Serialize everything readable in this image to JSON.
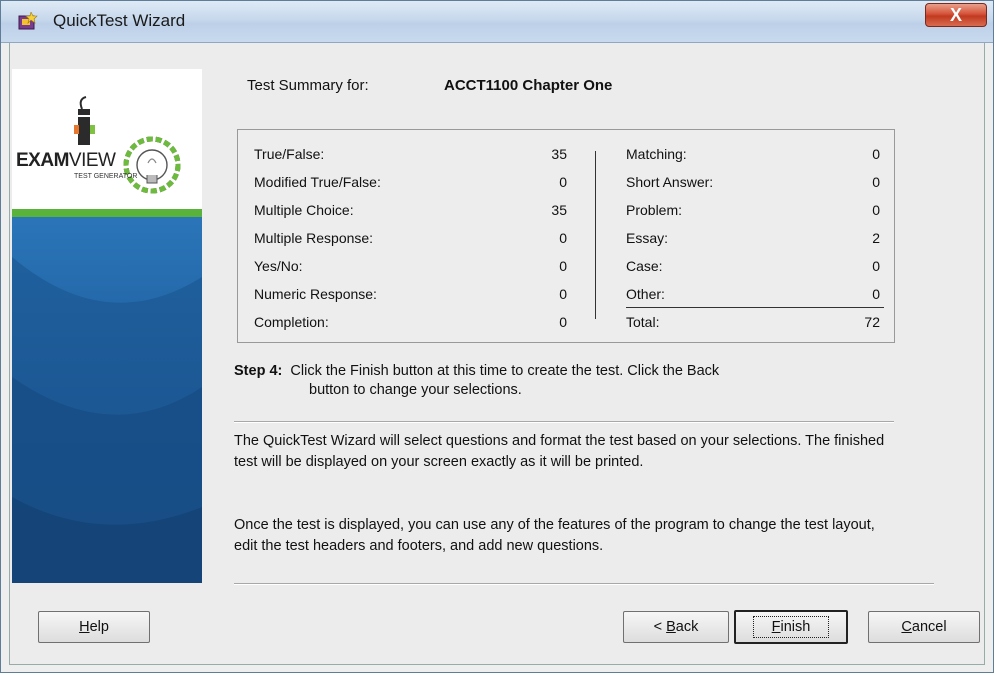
{
  "window": {
    "title": "QuickTest Wizard",
    "close_label": "X"
  },
  "branding": {
    "logo_bold": "EXAM",
    "logo_thin": "VIEW",
    "logo_sub": "TEST GENERATOR"
  },
  "summary": {
    "label": "Test Summary for:",
    "title": "ACCT1100 Chapter One"
  },
  "counts_left": [
    {
      "label": "True/False:",
      "value": "35"
    },
    {
      "label": "Modified True/False:",
      "value": "0"
    },
    {
      "label": "Multiple Choice:",
      "value": "35"
    },
    {
      "label": "Multiple Response:",
      "value": "0"
    },
    {
      "label": "Yes/No:",
      "value": "0"
    },
    {
      "label": "Numeric Response:",
      "value": "0"
    },
    {
      "label": "Completion:",
      "value": "0"
    }
  ],
  "counts_right": [
    {
      "label": "Matching:",
      "value": "0"
    },
    {
      "label": "Short Answer:",
      "value": "0"
    },
    {
      "label": "Problem:",
      "value": "0"
    },
    {
      "label": "Essay:",
      "value": "2"
    },
    {
      "label": "Case:",
      "value": "0"
    },
    {
      "label": "Other:",
      "value": "0"
    },
    {
      "label": "Total:",
      "value": "72"
    }
  ],
  "step": {
    "label": "Step 4:",
    "line1": "Click the Finish button at this time to create the test. Click the Back",
    "line2": "button to change your selections."
  },
  "info": {
    "para1": "The QuickTest Wizard will select questions and format the test based on your selections. The finished test will be displayed on your screen exactly as it will be printed.",
    "para2": "Once the test is displayed, you can use any of the features of the program to change the test layout, edit the test headers and footers, and add new questions."
  },
  "buttons": {
    "help_prefix": "",
    "help_key": "H",
    "help_rest": "elp",
    "back_prefix": "< ",
    "back_key": "B",
    "back_rest": "ack",
    "finish_key": "F",
    "finish_rest": "inish",
    "cancel_key": "C",
    "cancel_rest": "ancel"
  }
}
